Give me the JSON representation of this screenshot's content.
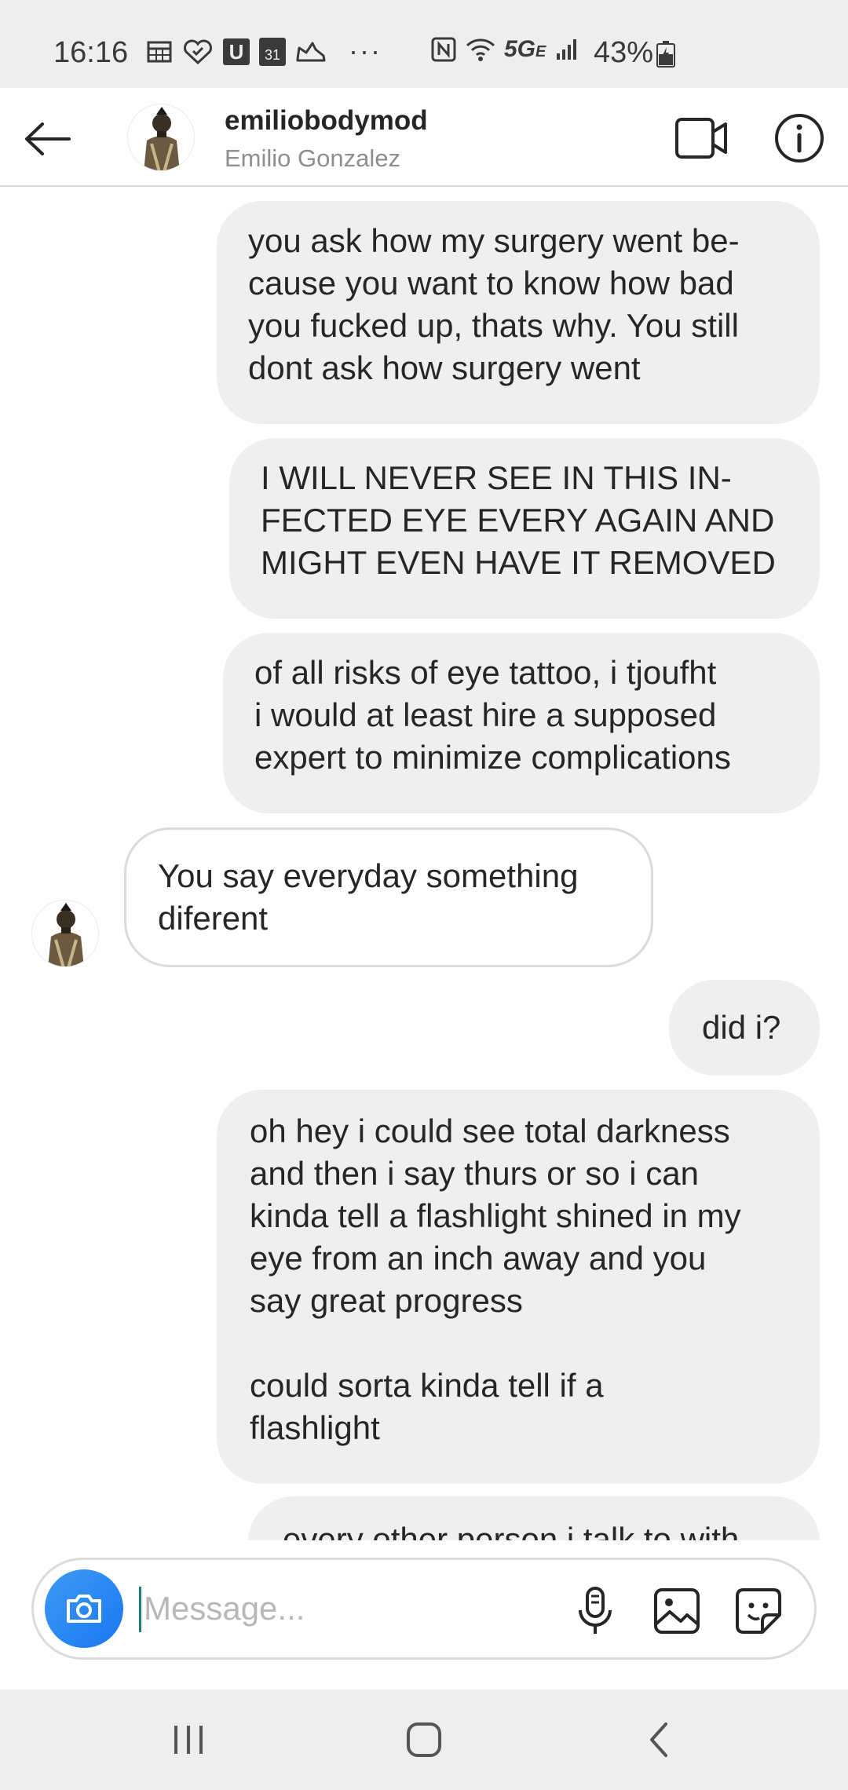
{
  "status_bar": {
    "time": "16:16",
    "overflow": "···",
    "network": "5G",
    "network_sub": "E",
    "battery": "43%",
    "icons": [
      "calendar-grid-icon",
      "iheart-icon",
      "u-app-icon",
      "calendar-31-icon",
      "shoe-icon",
      "nfc-icon",
      "wifi-icon",
      "signal-icon",
      "battery-icon"
    ],
    "calendar_day": "31",
    "u_app": "U"
  },
  "header": {
    "username": "emiliobodymod",
    "full_name": "Emilio Gonzalez",
    "icons": [
      "back-arrow-icon",
      "avatar",
      "video-camera-icon",
      "info-icon"
    ]
  },
  "messages": [
    {
      "direction": "outgoing",
      "text": "you ask how my surgery went be-\ncause you want to know how bad\nyou fucked up, thats why. You still\ndont ask how surgery went"
    },
    {
      "direction": "outgoing",
      "text": "I WILL NEVER SEE IN THIS IN-\nFECTED EYE EVERY AGAIN AND\nMIGHT EVEN HAVE IT REMOVED"
    },
    {
      "direction": "outgoing",
      "text": "of all risks of eye tattoo, i tjoufht\ni would at least hire a supposed\nexpert to minimize complications"
    },
    {
      "direction": "incoming",
      "text": "You say everyday something\ndiferent"
    },
    {
      "direction": "outgoing",
      "text": "did i?"
    },
    {
      "direction": "outgoing",
      "text": "oh hey i could see total darkness\nand then i say thurs or so i can\nkinda tell a flashlight shined in my\neye from an inch away and you\nsay great progress\n\ncould sorta kinda tell if a\nflashlight"
    },
    {
      "direction": "outgoing",
      "text": "every other person i talk to with"
    }
  ],
  "composer": {
    "placeholder": "Message...",
    "value": "",
    "icons": [
      "camera-icon",
      "microphone-icon",
      "gallery-icon",
      "sticker-icon"
    ]
  },
  "navigation": {
    "icons": [
      "recent-apps-icon",
      "home-icon",
      "back-icon"
    ]
  },
  "colors": {
    "status_bar_bg": "#eeeeee",
    "outgoing_bubble": "#efefef",
    "incoming_bubble_border": "#dbdbdb",
    "camera_button": "#1877f2",
    "placeholder": "#b8b8b8",
    "caret": "#1e7e78"
  }
}
